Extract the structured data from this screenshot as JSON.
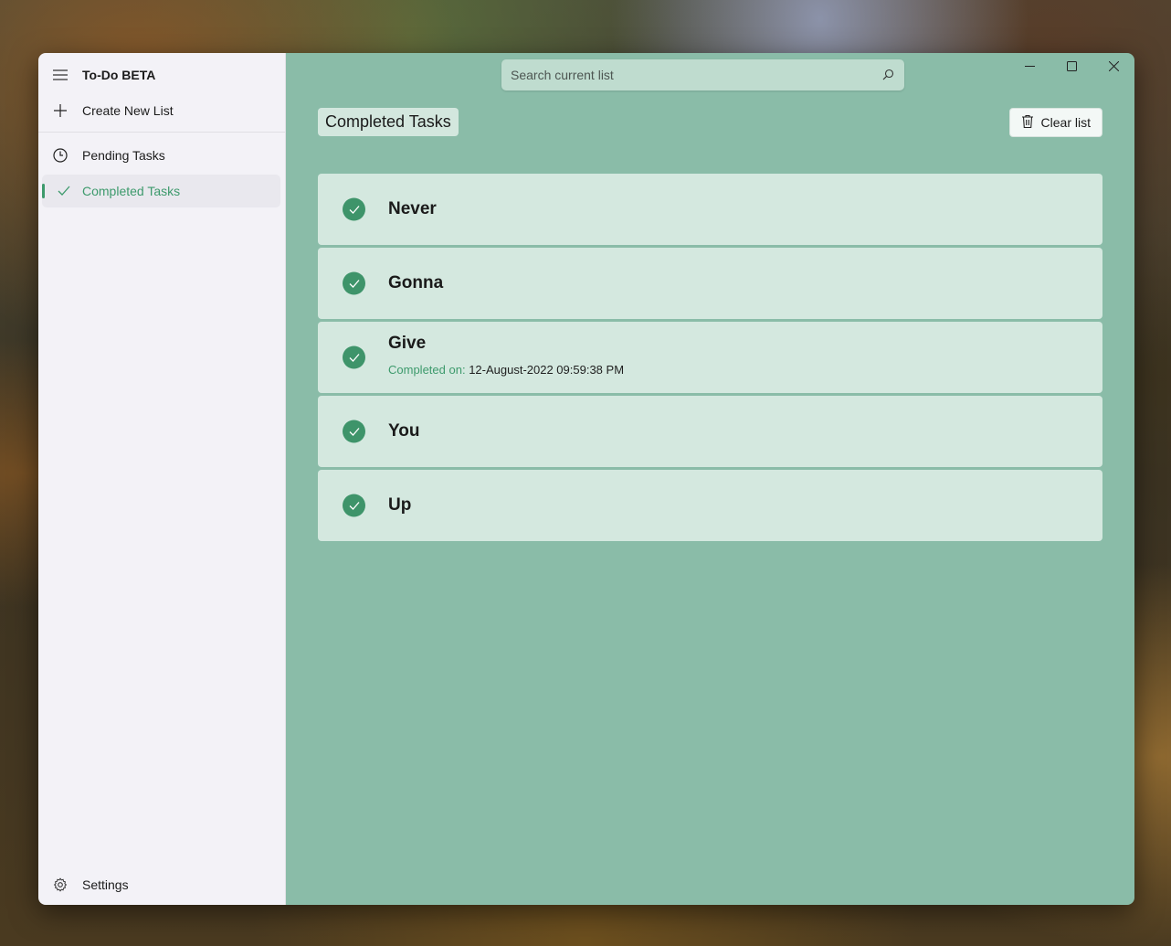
{
  "app": {
    "title": "To-Do BETA",
    "accent_color": "#3d9a6c"
  },
  "sidebar": {
    "menu_icon": "hamburger-icon",
    "create_list": {
      "icon": "plus-icon",
      "label": "Create New List"
    },
    "items": [
      {
        "icon": "clock-icon",
        "label": "Pending Tasks",
        "active": false
      },
      {
        "icon": "checkmark-icon",
        "label": "Completed Tasks",
        "active": true
      }
    ],
    "settings": {
      "icon": "gear-icon",
      "label": "Settings"
    }
  },
  "search": {
    "placeholder": "Search current list",
    "value": ""
  },
  "window_controls": {
    "minimize": "minimize-icon",
    "maximize": "maximize-icon",
    "close": "close-icon"
  },
  "main": {
    "page_title": "Completed Tasks",
    "clear_button": {
      "icon": "trash-icon",
      "label": "Clear list"
    },
    "tasks": [
      {
        "title": "Never",
        "completed": true
      },
      {
        "title": "Gonna",
        "completed": true
      },
      {
        "title": "Give",
        "completed": true,
        "meta_label": "Completed on:",
        "meta_value": "12-August-2022 09:59:38 PM"
      },
      {
        "title": "You",
        "completed": true
      },
      {
        "title": "Up",
        "completed": true
      }
    ]
  }
}
